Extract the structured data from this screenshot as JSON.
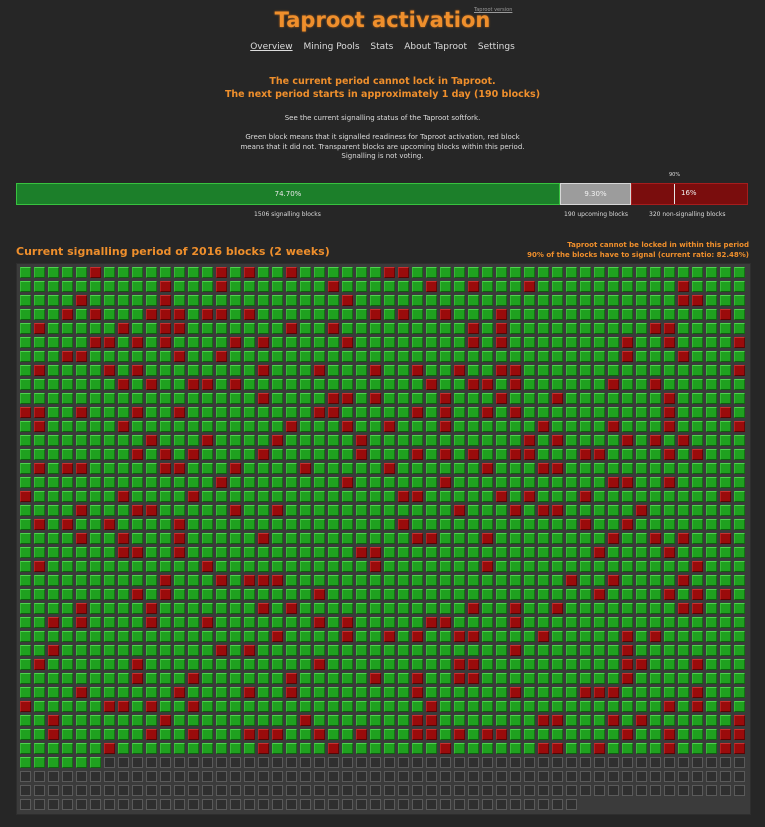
{
  "header": {
    "title": "Taproot activation",
    "tag": "Taproot version"
  },
  "nav": {
    "items": [
      "Overview",
      "Mining Pools",
      "Stats",
      "About Taproot",
      "Settings"
    ],
    "active": "Overview"
  },
  "status": {
    "line1": "The current period cannot lock in Taproot.",
    "line2": "The next period starts in approximately 1 day (190 blocks)"
  },
  "info": {
    "line1": "See the current signalling status of the Taproot softfork.",
    "line2": "Green block means that it signalled readiness for Taproot activation, red block",
    "line3": "means that it did not. Transparent blocks are upcoming blocks within this period.",
    "line4": "Signalling is not voting."
  },
  "progress": {
    "threshold_label": "90%",
    "signalling_pct": "74.70%",
    "upcoming_pct": "9.30%",
    "nonsignalling_pct": "16%",
    "signalling_label": "1506 signalling blocks",
    "upcoming_label": "190 upcoming blocks",
    "nonsignalling_label": "320 non-signalling blocks"
  },
  "period": {
    "title": "Current signalling period of 2016 blocks (2 weeks)",
    "lock_line1": "Taproot cannot be locked in within this period",
    "lock_line2": "90% of the blocks have to signal (current ratio: 82.48%)"
  },
  "blocks": {
    "total": 2016,
    "signalling": 1506,
    "non_signalling": 320,
    "upcoming": 190,
    "colors": {
      "signalling": "#1fa11f",
      "non_signalling": "#9a0b0b",
      "upcoming": "#2f2f2f"
    }
  }
}
